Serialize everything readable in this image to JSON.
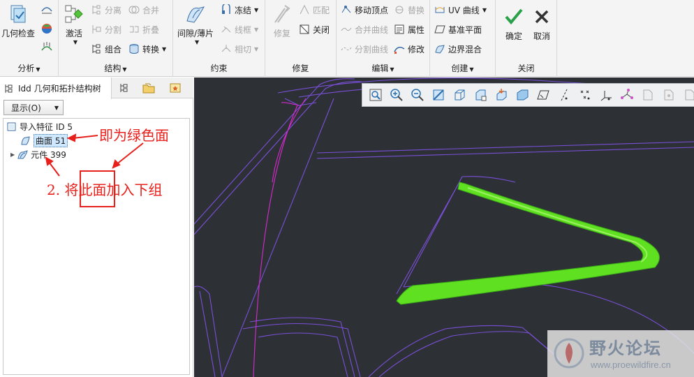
{
  "ribbon": {
    "analysis": {
      "label": "分析",
      "geometry_check": "几何检查"
    },
    "structure": {
      "label": "结构",
      "activate": "激活",
      "separate": "分离",
      "merge": "合并",
      "split": "分割",
      "fold": "折叠",
      "group": "组合",
      "convert": "转换"
    },
    "constraint": {
      "label": "约束",
      "gap_sheet": "间隙/薄片",
      "freeze": "冻结",
      "wireframe": "线框",
      "tangent": "相切"
    },
    "repair": {
      "label": "修复",
      "repair": "修复",
      "match": "匹配",
      "close": "关闭"
    },
    "edit": {
      "label": "编辑",
      "move_vertex": "移动顶点",
      "replace": "替换",
      "merge_curves": "合并曲线",
      "properties": "属性",
      "split_curves": "分割曲线",
      "modify": "修改"
    },
    "create": {
      "label": "创建",
      "uv_curve": "UV 曲线",
      "datum_plane": "基准平面",
      "boundary_blend": "边界混合"
    },
    "close": {
      "label": "关闭",
      "ok": "确定",
      "cancel": "取消"
    }
  },
  "left_panel": {
    "tree_tab": "Idd 几何和拓扑结构树",
    "show_button": "显示(O)",
    "tree": {
      "root": "导入特征 ID 5",
      "surface": "曲面 51",
      "component": "元件 399"
    },
    "annotations": {
      "green_face": "即为绿色面",
      "instruction": "2. 将此面加入下组"
    }
  },
  "watermark": {
    "title": "野火论坛",
    "url": "www.proewildfire.cn"
  },
  "colors": {
    "viewport_bg": "#2d3135",
    "highlight_surface": "#5fe020",
    "wire_purple": "#7a4fd8",
    "wire_magenta": "#d82ad0",
    "annotation_red": "#e8201c"
  }
}
